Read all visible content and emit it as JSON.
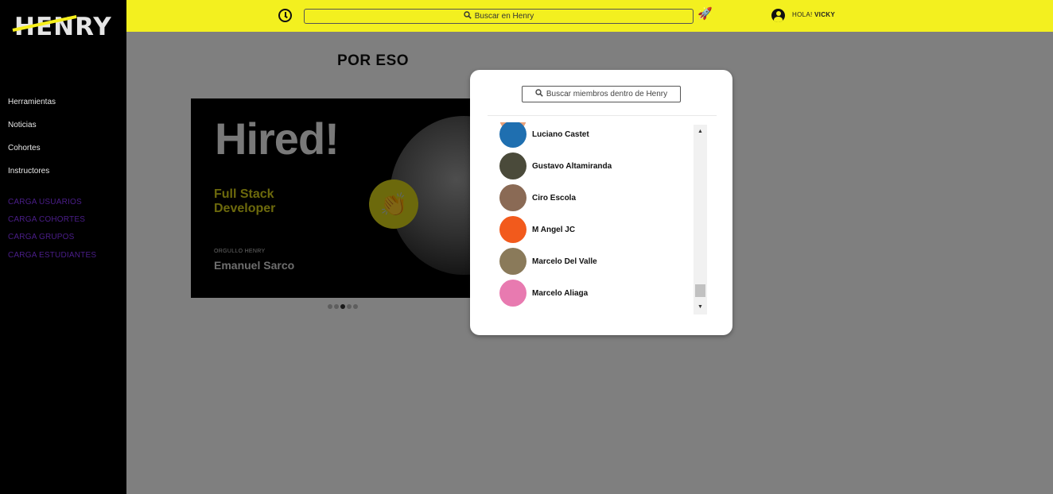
{
  "brand": {
    "logo_text": "HENRY"
  },
  "sidebar": {
    "items": [
      {
        "label": "Herramientas"
      },
      {
        "label": "Noticias"
      },
      {
        "label": "Cohortes"
      },
      {
        "label": "Instructores"
      }
    ],
    "admin_items": [
      {
        "label": "CARGA USUARIOS"
      },
      {
        "label": "CARGA COHORTES"
      },
      {
        "label": "CARGA GRUPOS"
      },
      {
        "label": "CARGA ESTUDIANTES"
      }
    ]
  },
  "header": {
    "search_placeholder": "Buscar en Henry",
    "greeting_prefix": "HOLA!",
    "user_name": "VICKY"
  },
  "main": {
    "section_title": "POR ESO",
    "banner": {
      "headline": "Hired!",
      "role_line1": "Full Stack",
      "role_line2": "Developer",
      "tagline": "ORGULLO HENRY",
      "person": "Emanuel Sarco"
    },
    "carousel": {
      "total": 5,
      "active_index": 2
    }
  },
  "modal": {
    "search_placeholder": "Buscar miembros dentro de Henry",
    "members": [
      {
        "name": "Luciano Castet",
        "avatar_color": "#1f6fb0"
      },
      {
        "name": "Gustavo Altamiranda",
        "avatar_color": "#4a4a3a"
      },
      {
        "name": "Ciro Escola",
        "avatar_color": "#8a6a55"
      },
      {
        "name": "M Angel JC",
        "avatar_color": "#f25a1c"
      },
      {
        "name": "Marcelo Del Valle",
        "avatar_color": "#8a7a5a"
      },
      {
        "name": "Marcelo Aliaga",
        "avatar_color": "#e87ab0"
      }
    ]
  },
  "colors": {
    "accent_yellow": "#f3f01f",
    "sidebar_bg": "#000000",
    "admin_link": "#4b1e8a"
  }
}
